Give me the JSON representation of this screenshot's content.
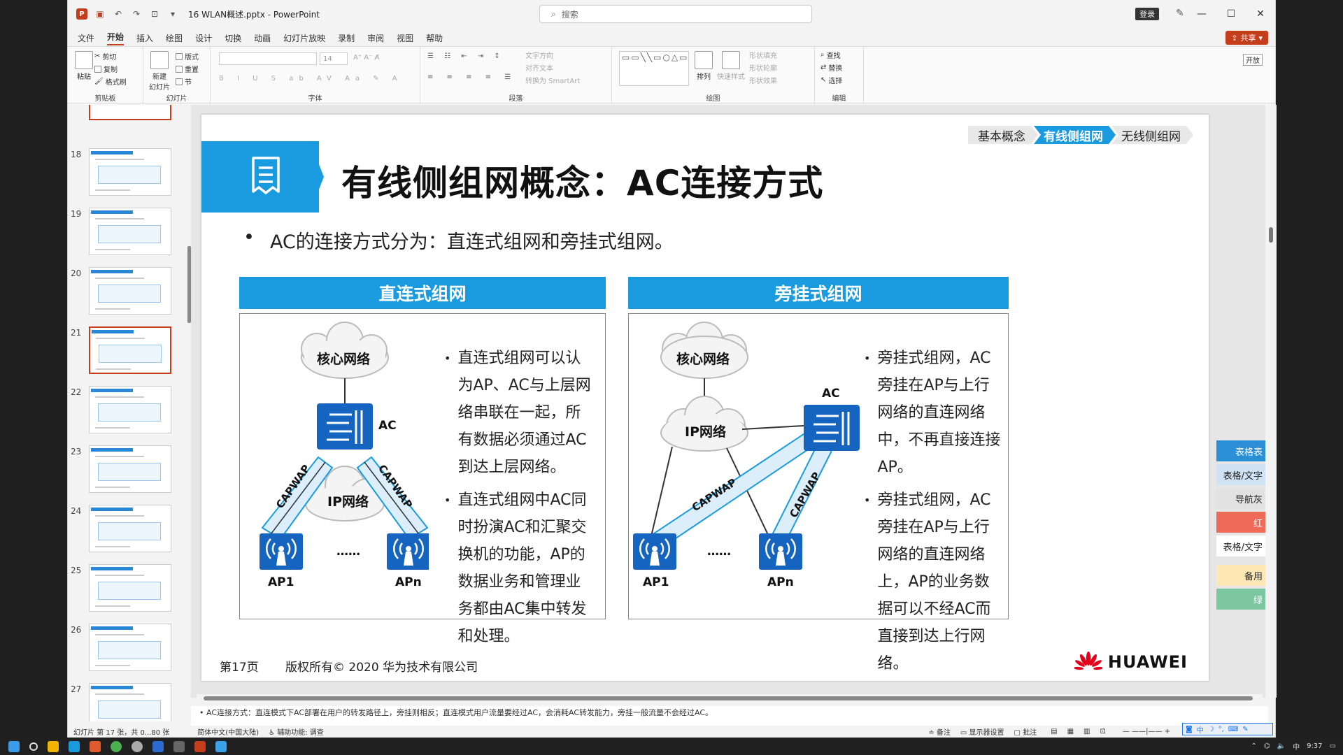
{
  "window": {
    "doc_title": "16 WLAN概述.pptx",
    "app_name": "PowerPoint",
    "search_placeholder": "搜索",
    "login_label": "登录",
    "share_label": "共享"
  },
  "menu_tabs": [
    "文件",
    "开始",
    "插入",
    "绘图",
    "设计",
    "切换",
    "动画",
    "幻灯片放映",
    "录制",
    "审阅",
    "视图",
    "帮助"
  ],
  "ribbon": {
    "clipboard": {
      "paste": "粘贴",
      "cut": "剪切",
      "copy": "复制",
      "format_painter": "格式刷",
      "label": "剪贴板"
    },
    "slides": {
      "new_slide": "新建",
      "new_slide2": "幻灯片",
      "layout": "版式",
      "reset": "重置",
      "section": "节",
      "label": "幻灯片"
    },
    "font": {
      "font_size": "14",
      "label": "字体"
    },
    "paragraph": {
      "text_direction": "文字方向",
      "align_text": "对齐文本",
      "smartart": "转换为 SmartArt",
      "label": "段落"
    },
    "drawing": {
      "arrange": "排列",
      "quick_styles": "快速样式",
      "shape_fill": "形状填充",
      "shape_outline": "形状轮廓",
      "shape_effects": "形状效果",
      "label": "绘图"
    },
    "editing": {
      "find": "查找",
      "replace": "替换",
      "select": "选择",
      "label": "编辑"
    },
    "addin_label": "开放"
  },
  "thumbnails": [
    {
      "num": "18"
    },
    {
      "num": "19"
    },
    {
      "num": "20"
    },
    {
      "num": "21"
    },
    {
      "num": "22"
    },
    {
      "num": "23"
    },
    {
      "num": "24"
    },
    {
      "num": "25"
    },
    {
      "num": "26"
    },
    {
      "num": "27"
    }
  ],
  "slide": {
    "breadcrumb": [
      "基本概念",
      "有线侧组网",
      "无线侧组网"
    ],
    "title": "有线侧组网概念：AC连接方式",
    "main_bullet": "AC的连接方式分为：直连式组网和旁挂式组网。",
    "left_panel": {
      "header": "直连式组网",
      "cloud_core": "核心网络",
      "cloud_ip": "IP网络",
      "ac": "AC",
      "capwap": "CAPWAP",
      "ap1": "AP1",
      "apn": "APn",
      "dots": "……",
      "bullets": [
        "直连式组网可以认为AP、AC与上层网络串联在一起，所有数据必须通过AC到达上层网络。",
        "直连式组网中AC同时扮演AC和汇聚交换机的功能，AP的数据业务和管理业务都由AC集中转发和处理。"
      ]
    },
    "right_panel": {
      "header": "旁挂式组网",
      "cloud_core": "核心网络",
      "cloud_ip": "IP网络",
      "ac": "AC",
      "capwap": "CAPWAP",
      "ap1": "AP1",
      "apn": "APn",
      "dots": "……",
      "bullets": [
        "旁挂式组网，AC旁挂在AP与上行网络的直连网络中，不再直接连接AP。",
        "旁挂式组网，AC旁挂在AP与上行网络的直连网络上，AP的业务数据可以不经AC而直接到达上行网络。"
      ]
    },
    "footer_page": "第17页",
    "footer_copyright": "版权所有© 2020 华为技术有限公司",
    "brand": "HUAWEI"
  },
  "notes": "• AC连接方式：直连模式下AC部署在用户的转发路径上，旁挂则相反；直连模式用户流量要经过AC，会消耗AC转发能力，旁挂一般流量不会经过AC。",
  "status": {
    "slide_info": "幻灯片 第 17 张，共 0...80 张",
    "language": "简体中文(中国大陆)",
    "accessibility": "辅助功能: 调查",
    "notes_btn": "备注",
    "display_settings": "显示器设置",
    "comments": "批注"
  },
  "side_labels": [
    {
      "text": "表格表",
      "color": "#2b8fd6",
      "fg": "#ffffff"
    },
    {
      "text": "表格/文字",
      "color": "#cfe3f5",
      "fg": "#222222"
    },
    {
      "text": "导航灰",
      "color": "#e2e2e2",
      "fg": "#222222"
    },
    {
      "text": "红",
      "color": "#f06a5a",
      "fg": "#ffffff"
    },
    {
      "text": "表格/文字",
      "color": "#ffffff",
      "fg": "#222222"
    },
    {
      "text": "备用",
      "color": "#fde7b4",
      "fg": "#222222"
    },
    {
      "text": "绿",
      "color": "#7cc7a0",
      "fg": "#ffffff"
    }
  ],
  "taskbar": {
    "time": "9:37"
  },
  "colors": {
    "accent_blue": "#1a9be0",
    "ppt_red": "#c43e1c",
    "huawei_red": "#e3001b"
  }
}
